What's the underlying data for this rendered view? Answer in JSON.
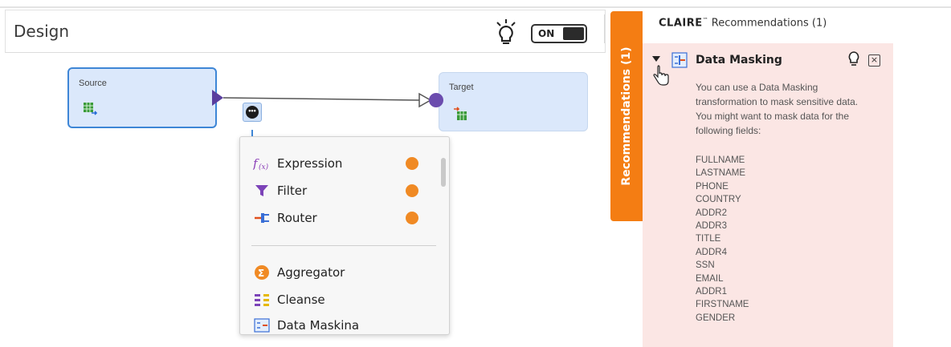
{
  "design": {
    "title": "Design",
    "toggle_label": "ON"
  },
  "canvas": {
    "source": {
      "label": "Source"
    },
    "target": {
      "label": "Target"
    },
    "add_menu_symbol": "•••"
  },
  "menu": {
    "items": [
      {
        "label": "Expression",
        "icon": "expression-icon",
        "hint": true
      },
      {
        "label": "Filter",
        "icon": "filter-icon",
        "hint": true
      },
      {
        "label": "Router",
        "icon": "router-icon",
        "hint": true
      },
      {
        "label": "Aggregator",
        "icon": "aggregator-icon",
        "hint": false
      },
      {
        "label": "Cleanse",
        "icon": "cleanse-icon",
        "hint": false
      },
      {
        "label": "Data Maskina",
        "icon": "data-masking-icon",
        "hint": false
      }
    ]
  },
  "recommendations": {
    "tab_label": "Recommendations (1)",
    "header_brand": "CLAIRE",
    "header_tm": "™",
    "header_rest": " Recommendations (1)",
    "item_title": "Data Masking",
    "close_symbol": "×",
    "description": "You can use a Data Masking transformation to mask sensitive data. You might want to mask data for the following fields:",
    "fields": [
      "FULLNAME",
      "LASTNAME",
      "PHONE",
      "COUNTRY",
      "ADDR2",
      "ADDR3",
      "TITLE",
      "ADDR4",
      "SSN",
      "EMAIL",
      "ADDR1",
      "FIRSTNAME",
      "GENDER"
    ]
  },
  "colors": {
    "accent_orange": "#f47d13",
    "node_fill": "#dbe8fb",
    "node_selected_border": "#3e86d6",
    "port_purple": "#5a3e9e",
    "panel_bg": "#fbe6e4"
  }
}
